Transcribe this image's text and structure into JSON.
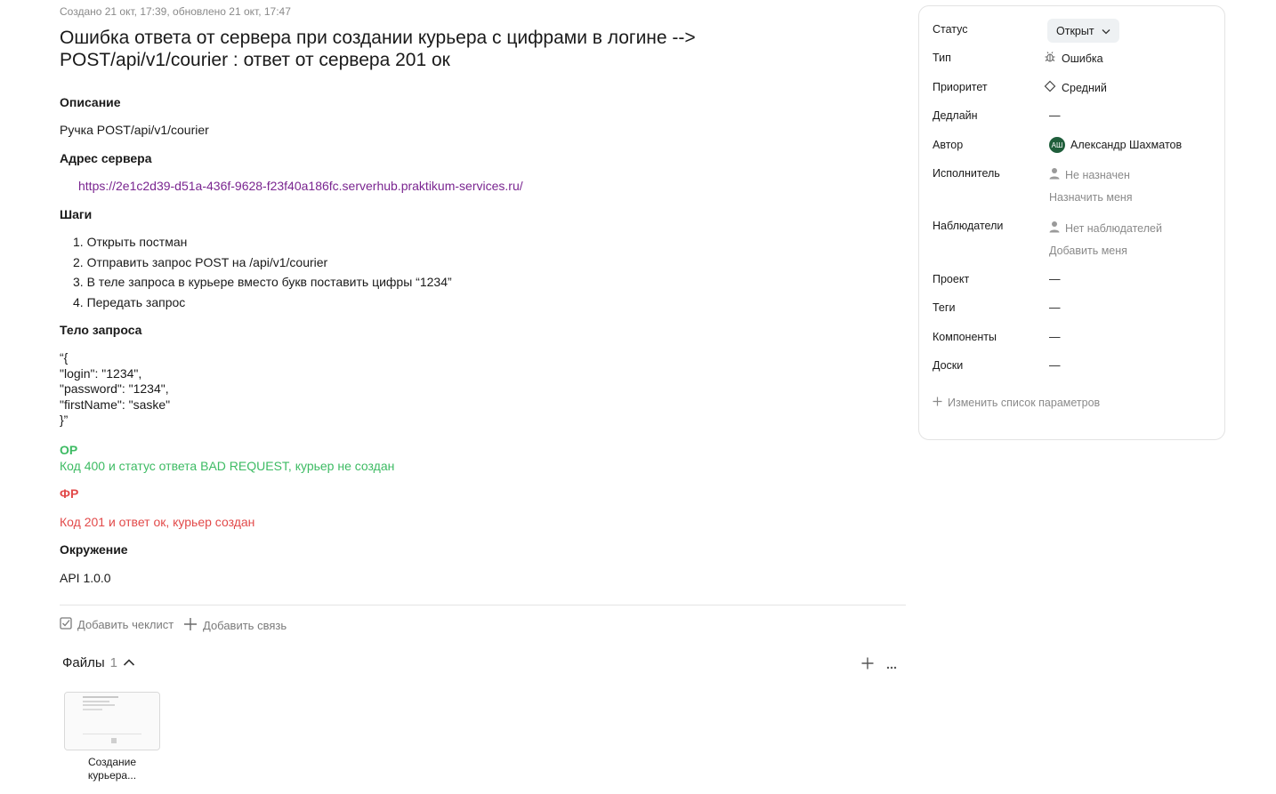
{
  "meta": "Создано 21 окт, 17:39, обновлено 21 окт, 17:47",
  "title": "Ошибка ответа от сервера при создании курьера с цифрами в логине --> POST/api/v1/courier : ответ от сервера 201 ок",
  "description": {
    "heading": "Описание",
    "text": "Ручка POST/api/v1/courier"
  },
  "server": {
    "heading": "Адрес сервера",
    "url": "https://2e1c2d39-d51a-436f-9628-f23f40a186fc.serverhub.praktikum-services.ru/"
  },
  "steps": {
    "heading": "Шаги",
    "items": [
      "1. Открыть постман",
      "2. Отправить запрос POST на /api/v1/courier",
      "3. В теле запроса в курьере вместо букв поставить цифры “1234”",
      "4. Передать запрос"
    ]
  },
  "body": {
    "heading": "Тело запроса",
    "lines": [
      "“{",
      "\"login\": \"1234\",",
      "\"password\": \"1234\",",
      "\"firstName\": \"saske\"",
      "}”"
    ]
  },
  "expected": {
    "label": "ОР",
    "text": "Код 400 и статус ответа BAD REQUEST, курьер не создан"
  },
  "actual": {
    "label": "ФР",
    "text": "Код 201 и ответ ок, курьер создан"
  },
  "environment": {
    "heading": "Окружение",
    "text": "API 1.0.0"
  },
  "actions": {
    "checklist": "Добавить чеклист",
    "link": "Добавить связь"
  },
  "files": {
    "heading": "Файлы",
    "count": "1",
    "items": [
      {
        "caption": "Создание курьера..."
      }
    ]
  },
  "panel": {
    "status": {
      "label": "Статус",
      "value": "Открыт"
    },
    "type": {
      "label": "Тип",
      "value": "Ошибка"
    },
    "priority": {
      "label": "Приоритет",
      "value": "Средний"
    },
    "deadline": {
      "label": "Дедлайн",
      "value": "—"
    },
    "author": {
      "label": "Автор",
      "value": "Александр Шахматов",
      "initials": "АШ"
    },
    "assignee": {
      "label": "Исполнитель",
      "value": "Не назначен",
      "action": "Назначить меня"
    },
    "followers": {
      "label": "Наблюдатели",
      "value": "Нет наблюдателей",
      "action": "Добавить меня"
    },
    "project": {
      "label": "Проект",
      "value": "—"
    },
    "tags": {
      "label": "Теги",
      "value": "—"
    },
    "components": {
      "label": "Компоненты",
      "value": "—"
    },
    "boards": {
      "label": "Доски",
      "value": "—"
    },
    "change_params": "Изменить список параметров"
  }
}
